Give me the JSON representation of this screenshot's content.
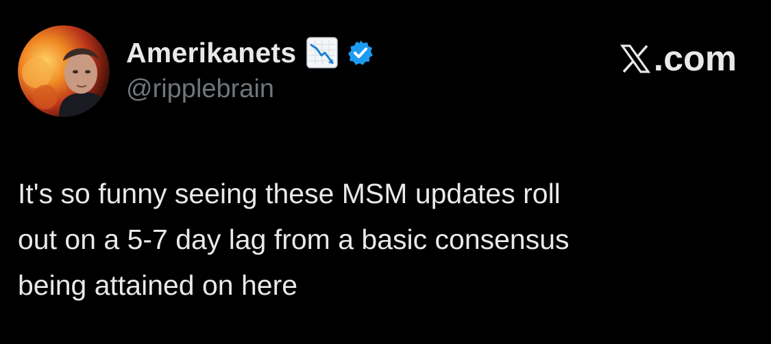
{
  "author": {
    "display_name": "Amerikanets",
    "name_emoji": "chart-decreasing-icon",
    "verified": true,
    "handle": "@ripplebrain",
    "avatar": "avatar"
  },
  "brand": {
    "icon": "x-logo-icon",
    "label": ".com"
  },
  "tweet": {
    "lines": [
      "It's so funny seeing these MSM updates roll",
      "out on a 5-7 day lag from a basic consensus",
      "being attained on here"
    ]
  },
  "colors": {
    "background": "#000000",
    "primary_text": "#e7e9ea",
    "secondary_text": "#71767b",
    "verified_blue": "#1d9bf0"
  }
}
